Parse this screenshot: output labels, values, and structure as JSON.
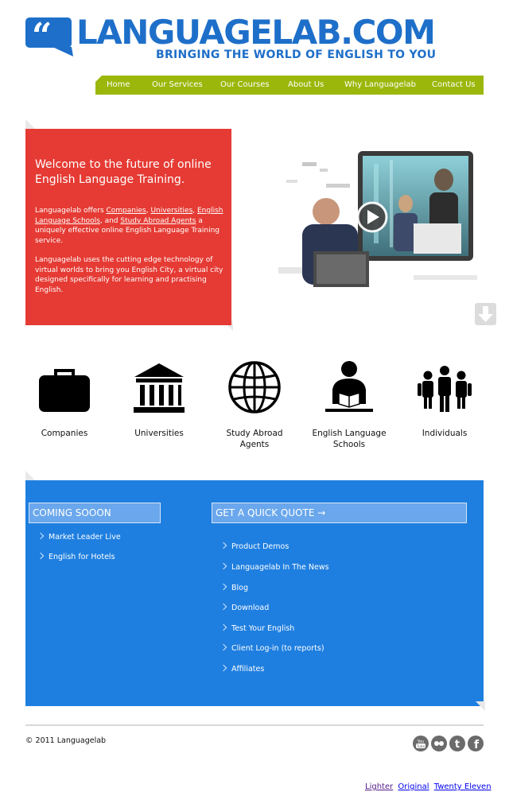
{
  "brand": {
    "logo_text": "LANGUAGELAB.COM",
    "tagline": "BRINGING THE WORLD OF ENGLISH TO YOU",
    "color": "#1e6fc9"
  },
  "nav": {
    "items": [
      "Home",
      "Our Services",
      "Our Courses",
      "About Us",
      "Why Languagelab",
      "Contact Us"
    ],
    "color": "#9bb70b"
  },
  "welcome": {
    "title": "Welcome to the future of online English Language Training.",
    "p1_prefix": "Languagelab offers ",
    "p1_links": [
      "Companies",
      "Universities",
      "English Language Schools",
      "Study Abroad Agents"
    ],
    "p1_sep1": ", ",
    "p1_sep2": ", ",
    "p1_sep3": ", and ",
    "p1_suffix": " a uniquely effective online English Language Training service.",
    "p2": "Languagelab uses the cutting edge technology of virtual worlds to bring you English City, a virtual city designed specifically for learning and practising English.",
    "color": "#e53b34"
  },
  "hero": {
    "play_icon": "play-icon",
    "scroll_icon": "arrow-down-icon"
  },
  "categories": [
    {
      "label": "Companies",
      "icon": "briefcase-icon"
    },
    {
      "label": "Universities",
      "icon": "university-icon"
    },
    {
      "label": "Study Abroad Agents",
      "icon": "globe-icon"
    },
    {
      "label": "English Language Schools",
      "icon": "reader-icon"
    },
    {
      "label": "Individuals",
      "icon": "people-icon"
    }
  ],
  "coming_soon": {
    "heading": "COMING SOOON",
    "items": [
      "Market Leader Live",
      "English for Hotels"
    ]
  },
  "quick_quote": {
    "heading": "GET A QUICK QUOTE →",
    "items": [
      "Product Demos",
      "Languagelab In The News",
      "Blog",
      "Download",
      "Test Your English",
      "Client Log-in (to reports)",
      "Affiliates"
    ]
  },
  "footer": {
    "copyright": "© 2011 Languagelab",
    "social": [
      "youtube-icon",
      "flickr-icon",
      "twitter-icon",
      "facebook-icon"
    ],
    "style_links": [
      "Lighter",
      "Original",
      "Twenty Eleven"
    ]
  },
  "colors": {
    "section_blue": "#1f7fe0",
    "link_purple": "#551a8b",
    "link_blue": "#0000ee"
  }
}
